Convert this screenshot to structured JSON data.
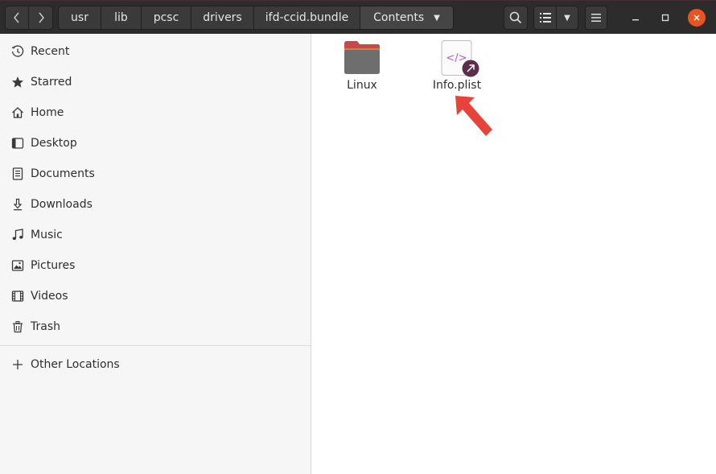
{
  "pathbar": {
    "crumbs": [
      "usr",
      "lib",
      "pcsc",
      "drivers",
      "ifd-ccid.bundle",
      "Contents"
    ]
  },
  "sidebar": {
    "items": [
      {
        "label": "Recent",
        "icon": "clock-icon"
      },
      {
        "label": "Starred",
        "icon": "star-icon"
      },
      {
        "label": "Home",
        "icon": "home-icon"
      },
      {
        "label": "Desktop",
        "icon": "desktop-icon"
      },
      {
        "label": "Documents",
        "icon": "document-icon"
      },
      {
        "label": "Downloads",
        "icon": "download-icon"
      },
      {
        "label": "Music",
        "icon": "music-icon"
      },
      {
        "label": "Pictures",
        "icon": "picture-icon"
      },
      {
        "label": "Videos",
        "icon": "video-icon"
      },
      {
        "label": "Trash",
        "icon": "trash-icon"
      }
    ],
    "other_locations": {
      "label": "Other Locations",
      "icon": "plus-icon"
    }
  },
  "files": [
    {
      "name": "Linux",
      "type": "folder",
      "icon": "folder-icon"
    },
    {
      "name": "Info.plist",
      "type": "xml-symlink",
      "icon": "xml-file-icon",
      "badge_icon": "symlink-arrow-icon"
    }
  ],
  "colors": {
    "header_bg": "#2c2c2c",
    "accent_close": "#e95420",
    "folder_tab": "#c7494c",
    "symlink_badge": "#5a2d4a",
    "annotation_arrow": "#e8433a"
  }
}
